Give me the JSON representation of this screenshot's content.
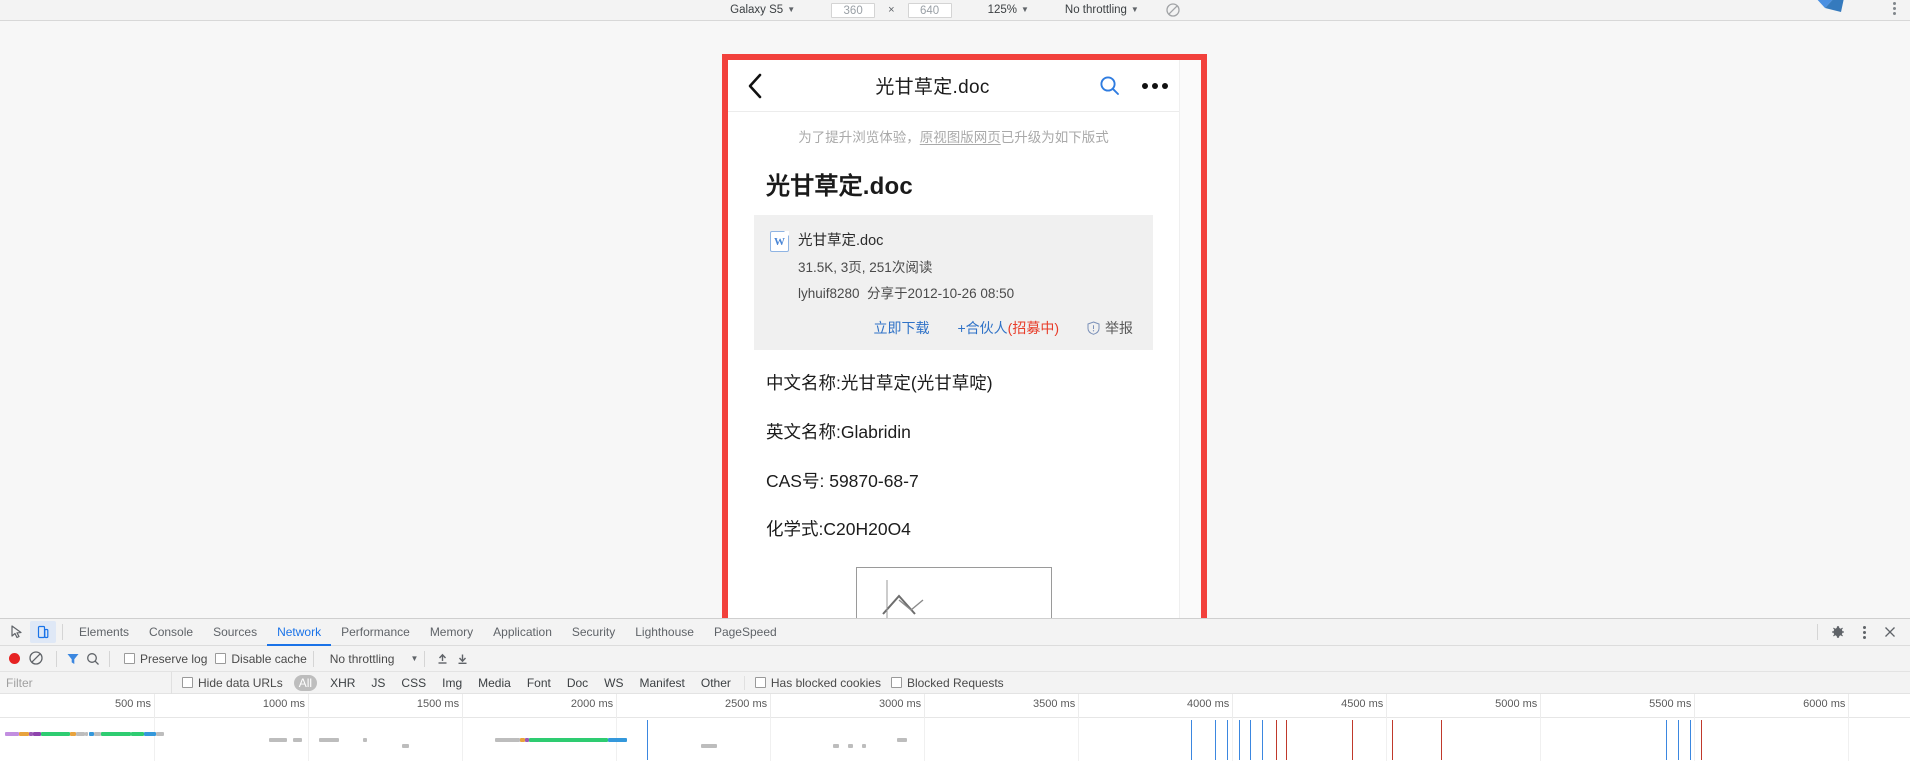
{
  "device_toolbar": {
    "device": "Galaxy S5",
    "width": "360",
    "height": "640",
    "zoom": "125%",
    "throttling": "No throttling",
    "rotate_icon": "rotate-icon",
    "caret": "▼",
    "times": "×"
  },
  "mobile_page": {
    "header": {
      "back_icon": "back-chevron-icon",
      "title": "光甘草定.doc",
      "search_icon": "search-icon",
      "more_icon": "more-dots-icon"
    },
    "notice": {
      "before": "为了提升浏览体验，",
      "link": "原视图版网页",
      "after": "已升级为如下版式"
    },
    "heading": "光甘草定.doc",
    "file_card": {
      "word_icon": "word-doc-icon",
      "filename": "光甘草定.doc",
      "meta": "31.5K, 3页, 251次阅读",
      "owner": "lyhuif8280  分享于2012-10-26 08:50",
      "download_label": "立即下载",
      "partner_label": "+合伙人",
      "partner_badge": "(招募中)",
      "report_label": "举报",
      "report_icon": "shield-report-icon"
    },
    "content": [
      "中文名称:光甘草定(光甘草啶)",
      "英文名称:Glabridin",
      "CAS号: 59870-68-7",
      "化学式:C20H20O4"
    ],
    "structure_image_name": "chemical-structure-image"
  },
  "devtools": {
    "inspect_icon": "inspect-element-icon",
    "device_toggle_icon": "toggle-device-toolbar-icon",
    "tabs": [
      {
        "label": "Elements",
        "active": false
      },
      {
        "label": "Console",
        "active": false
      },
      {
        "label": "Sources",
        "active": false
      },
      {
        "label": "Network",
        "active": true
      },
      {
        "label": "Performance",
        "active": false
      },
      {
        "label": "Memory",
        "active": false
      },
      {
        "label": "Application",
        "active": false
      },
      {
        "label": "Security",
        "active": false
      },
      {
        "label": "Lighthouse",
        "active": false
      },
      {
        "label": "PageSpeed",
        "active": false
      }
    ],
    "right_icons": [
      "gear-icon",
      "more-vertical-icon",
      "close-icon"
    ],
    "network_toolbar": {
      "record_icon": "record-button",
      "clear_icon": "clear-icon",
      "filter_icon": "filter-funnel-icon",
      "search_icon": "search-icon",
      "preserve_log": "Preserve log",
      "disable_cache": "Disable cache",
      "throttling": "No throttling",
      "import_icon": "import-har-icon",
      "export_icon": "export-har-icon"
    },
    "filter_row": {
      "placeholder": "Filter",
      "hide_data_urls": "Hide data URLs",
      "types": [
        "All",
        "XHR",
        "JS",
        "CSS",
        "Img",
        "Media",
        "Font",
        "Doc",
        "WS",
        "Manifest",
        "Other"
      ],
      "active_type": "All",
      "has_blocked_cookies": "Has blocked cookies",
      "blocked_requests": "Blocked Requests"
    },
    "timeline": {
      "ticks": [
        "500 ms",
        "1000 ms",
        "1500 ms",
        "2000 ms",
        "2500 ms",
        "3000 ms",
        "3500 ms",
        "4000 ms",
        "4500 ms",
        "5000 ms",
        "5500 ms",
        "6000 ms"
      ]
    }
  },
  "colors": {
    "highlight_red": "#f2413c",
    "devtools_blue": "#1a73e8",
    "link_blue": "#2f72c7",
    "badge_red": "#e83b28",
    "record_red": "#e62222"
  }
}
